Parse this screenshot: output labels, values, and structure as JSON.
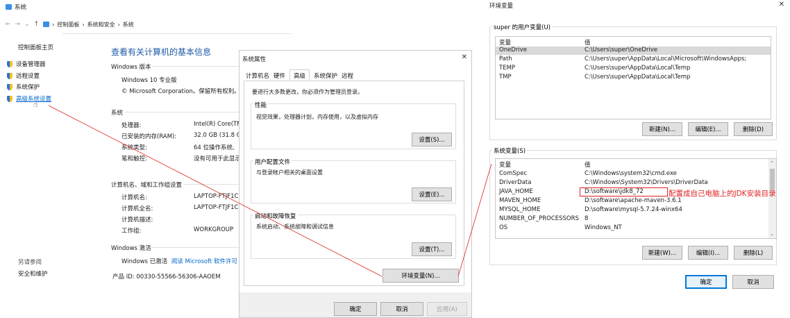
{
  "system_window": {
    "title": "系统",
    "breadcrumb": [
      "控制面板",
      "系统和安全",
      "系统"
    ],
    "sidebar": {
      "home": "控制面板主页",
      "items": [
        "设备管理器",
        "远程设置",
        "系统保护",
        "高级系统设置"
      ],
      "see_also_title": "另请参阅",
      "see_also": "安全和维护"
    },
    "heading": "查看有关计算机的基本信息",
    "edition_section": "Windows 版本",
    "edition": "Windows 10 专业版",
    "copyright": "© Microsoft Corporation。保留所有权利。",
    "system_section": "系统",
    "system_rows": [
      {
        "label": "处理器:",
        "value": "Intel(R) Core(TM"
      },
      {
        "label": "已安装的内存(RAM):",
        "value": "32.0 GB (31.8 G"
      },
      {
        "label": "系统类型:",
        "value": "64 位操作系统,"
      },
      {
        "label": "笔和触控:",
        "value": "没有可用于此显示"
      }
    ],
    "computer_section": "计算机名、域和工作组设置",
    "computer_rows": [
      {
        "label": "计算机名:",
        "value": "LAPTOP-FTJF1C"
      },
      {
        "label": "计算机全名:",
        "value": "LAPTOP-FTJF1C"
      },
      {
        "label": "计算机描述:",
        "value": ""
      },
      {
        "label": "工作组:",
        "value": "WORKGROUP"
      }
    ],
    "activation_section": "Windows 激活",
    "activated": "Windows 已激活",
    "license_link": "阅读 Microsoft 软件许可",
    "product_id": "产品 ID: 00330-55566-56306-AAOEM"
  },
  "properties_dialog": {
    "title": "系统属性",
    "close": "✕",
    "tabs": [
      "计算机名",
      "硬件",
      "高级",
      "系统保护",
      "远程"
    ],
    "active_tab": "高级",
    "admin_note": "要进行大多数更改，你必须作为管理员登录。",
    "performance": {
      "title": "性能",
      "desc": "视觉效果，处理器计划，内存使用，以及虚拟内存",
      "button": "设置(S)..."
    },
    "profiles": {
      "title": "用户配置文件",
      "desc": "与登录帐户相关的桌面设置",
      "button": "设置(E)..."
    },
    "startup": {
      "title": "启动和故障恢复",
      "desc": "系统启动、系统故障和调试信息",
      "button": "设置(T)..."
    },
    "env_button": "环境变量(N)...",
    "ok": "确定",
    "cancel": "取消",
    "apply": "应用(A)"
  },
  "env_dialog": {
    "title": "环境变量",
    "close": "✕",
    "user_section": "super 的用户变量(U)",
    "col_var": "变量",
    "col_val": "值",
    "user_vars": [
      {
        "name": "OneDrive",
        "value": "C:\\Users\\super\\OneDrive"
      },
      {
        "name": "Path",
        "value": "C:\\Users\\super\\AppData\\Local\\Microsoft\\WindowsApps;"
      },
      {
        "name": "TEMP",
        "value": "C:\\Users\\super\\AppData\\Local\\Temp"
      },
      {
        "name": "TMP",
        "value": "C:\\Users\\super\\AppData\\Local\\Temp"
      }
    ],
    "user_buttons": {
      "new": "新建(N)...",
      "edit": "编辑(E)...",
      "delete": "删除(D)"
    },
    "system_section": "系统变量(S)",
    "system_vars": [
      {
        "name": "ComSpec",
        "value": "C:\\Windows\\system32\\cmd.exe"
      },
      {
        "name": "DriverData",
        "value": "C:\\Windows\\System32\\Drivers\\DriverData"
      },
      {
        "name": "JAVA_HOME",
        "value": "D:\\software\\jdk8_72"
      },
      {
        "name": "MAVEN_HOME",
        "value": "D:\\software\\apache-maven-3.6.1"
      },
      {
        "name": "MYSQL_HOME",
        "value": "D:\\software\\mysql-5.7.24-winx64"
      },
      {
        "name": "NUMBER_OF_PROCESSORS",
        "value": "8"
      },
      {
        "name": "OS",
        "value": "Windows_NT"
      }
    ],
    "system_buttons": {
      "new": "新建(W)...",
      "edit": "编辑(I)...",
      "delete": "删除(L)"
    },
    "ok": "确定",
    "cancel": "取消",
    "annotation": "配置成自己电脑上的JDK安装目录"
  },
  "colors": {
    "link": "#0066cc",
    "annotation": "#e02020",
    "selection": "#d9d9d9",
    "accent": "#0078d7"
  }
}
